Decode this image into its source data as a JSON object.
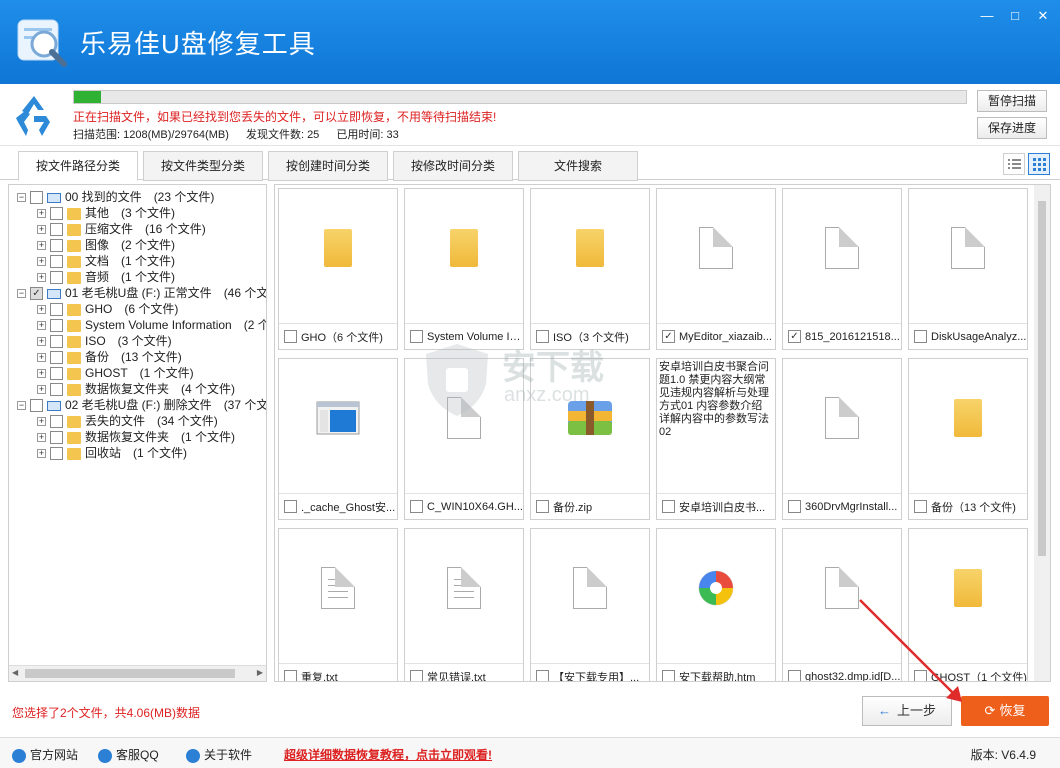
{
  "window": {
    "title": "乐易佳U盘修复工具",
    "controls": [
      "—",
      "□",
      "✕"
    ]
  },
  "scan": {
    "progress_fraction": 0.03,
    "message": "正在扫描文件，如果已经找到您丢失的文件，可以立即恢复，不用等待扫描结束!",
    "range_label": "扫描范围: 1208(MB)/29764(MB)",
    "found_label": "发现文件数: 25",
    "time_label": "已用时间: 33",
    "pause_button": "暂停扫描",
    "save_button": "保存进度"
  },
  "tabs": [
    {
      "label": "按文件路径分类",
      "active": true
    },
    {
      "label": "按文件类型分类",
      "active": false
    },
    {
      "label": "按创建时间分类",
      "active": false
    },
    {
      "label": "按修改时间分类",
      "active": false
    },
    {
      "label": "文件搜索",
      "active": false
    }
  ],
  "tree": {
    "nodes": [
      {
        "label": "00 找到的文件",
        "count": "(23 个文件)",
        "level": 0,
        "type": "drive",
        "check": "none"
      },
      {
        "label": "其他",
        "count": "(3 个文件)",
        "level": 1,
        "type": "folder",
        "check": "none"
      },
      {
        "label": "压缩文件",
        "count": "(16 个文件)",
        "level": 1,
        "type": "folder",
        "check": "none"
      },
      {
        "label": "图像",
        "count": "(2 个文件)",
        "level": 1,
        "type": "folder",
        "check": "none"
      },
      {
        "label": "文档",
        "count": "(1 个文件)",
        "level": 1,
        "type": "folder",
        "check": "none"
      },
      {
        "label": "音频",
        "count": "(1 个文件)",
        "level": 1,
        "type": "folder",
        "check": "none"
      },
      {
        "label": "01 老毛桃U盘 (F:) 正常文件",
        "count": "(46 个文件",
        "level": 0,
        "type": "drive",
        "check": "partial"
      },
      {
        "label": "GHO",
        "count": "(6 个文件)",
        "level": 1,
        "type": "folder",
        "check": "none"
      },
      {
        "label": "System Volume Information",
        "count": "(2 个文",
        "level": 1,
        "type": "folder",
        "check": "none"
      },
      {
        "label": "ISO",
        "count": "(3 个文件)",
        "level": 1,
        "type": "folder",
        "check": "none"
      },
      {
        "label": "备份",
        "count": "(13 个文件)",
        "level": 1,
        "type": "folder",
        "check": "none"
      },
      {
        "label": "GHOST",
        "count": "(1 个文件)",
        "level": 1,
        "type": "folder",
        "check": "none"
      },
      {
        "label": "数据恢复文件夹",
        "count": "(4 个文件)",
        "level": 1,
        "type": "folder",
        "check": "none"
      },
      {
        "label": "02 老毛桃U盘 (F:) 删除文件",
        "count": "(37 个文件",
        "level": 0,
        "type": "drive",
        "check": "none"
      },
      {
        "label": "丢失的文件",
        "count": "(34 个文件)",
        "level": 1,
        "type": "folder",
        "check": "none"
      },
      {
        "label": "数据恢复文件夹",
        "count": "(1 个文件)",
        "level": 1,
        "type": "folder",
        "check": "none"
      },
      {
        "label": "回收站",
        "count": "(1 个文件)",
        "level": 1,
        "type": "folder",
        "check": "none"
      }
    ]
  },
  "files": [
    {
      "label": "GHO（6 个文件)",
      "thumb": "folder",
      "checked": false
    },
    {
      "label": "System Volume In...",
      "thumb": "folder",
      "checked": false
    },
    {
      "label": "ISO（3 个文件)",
      "thumb": "folder",
      "checked": false
    },
    {
      "label": "MyEditor_xiazaib...",
      "thumb": "doc",
      "checked": true
    },
    {
      "label": "815_2016121518...",
      "thumb": "doc",
      "checked": true
    },
    {
      "label": "DiskUsageAnalyz...",
      "thumb": "doc",
      "checked": false
    },
    {
      "label": "._cache_Ghost安...",
      "thumb": "app",
      "checked": false
    },
    {
      "label": "C_WIN10X64.GH...",
      "thumb": "doc",
      "checked": false
    },
    {
      "label": "备份.zip",
      "thumb": "zip",
      "checked": false
    },
    {
      "label": "安卓培训白皮书...",
      "thumb": "text",
      "checked": false,
      "preview": "安卓培训白皮书聚合问题1.0\n禁更内容大纲常见违规内容解析与处理方式01\n内容参数介绍详解内容中的参数写法02"
    },
    {
      "label": "360DrvMgrInstall...",
      "thumb": "doc",
      "checked": false
    },
    {
      "label": "备份（13 个文件)",
      "thumb": "folder",
      "checked": false
    },
    {
      "label": "重复.txt",
      "thumb": "txt",
      "checked": false
    },
    {
      "label": "常见错误.txt",
      "thumb": "txt",
      "checked": false
    },
    {
      "label": "【安下载专用】...",
      "thumb": "doc",
      "checked": false
    },
    {
      "label": "安下载帮助.htm",
      "thumb": "htm",
      "checked": false
    },
    {
      "label": "ghost32.dmp.id[D...",
      "thumb": "doc",
      "checked": false
    },
    {
      "label": "GHOST（1 个文件)",
      "thumb": "folder",
      "checked": false
    }
  ],
  "watermark": {
    "text": "安下载",
    "sub": "anxz.com"
  },
  "bottom": {
    "selection_info": "您选择了2个文件，共4.06(MB)数据",
    "prev_button": "上一步",
    "recover_button": "恢复"
  },
  "statusbar": {
    "website": "官方网站",
    "support": "客服QQ",
    "about": "关于软件",
    "tutorial_link": "超级详细数据恢复教程，点击立即观看!",
    "version": "版本: V6.4.9"
  },
  "colors": {
    "titlebar": "#1680e0",
    "accent": "#ef5f1c",
    "warning_text": "#dd2222",
    "progress": "#2fb134"
  }
}
